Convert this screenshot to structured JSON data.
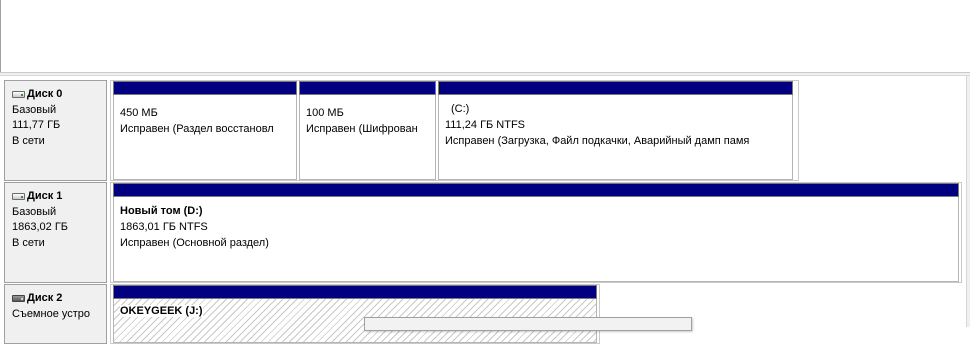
{
  "disks": [
    {
      "name": "Диск 0",
      "type": "Базовый",
      "size": "111,77 ГБ",
      "status": "В сети",
      "icon": "hard-disk-icon",
      "partitions": [
        {
          "size_text": "450 МБ",
          "status_text": "Исправен (Раздел восстановл"
        },
        {
          "size_text": "100 МБ",
          "status_text": "Исправен (Шифрован"
        },
        {
          "label": "(C:)",
          "size_text": "111,24 ГБ NTFS",
          "status_text": "Исправен (Загрузка, Файл подкачки, Аварийный дамп памя"
        }
      ]
    },
    {
      "name": "Диск 1",
      "type": "Базовый",
      "size": "1863,02 ГБ",
      "status": "В сети",
      "icon": "hard-disk-icon",
      "partitions": [
        {
          "label": "Новый том  (D:)",
          "size_text": "1863,01 ГБ NTFS",
          "status_text": "Исправен (Основной раздел)"
        }
      ]
    },
    {
      "name": "Диск 2",
      "type": "Съемное устро",
      "icon": "removable-disk-icon",
      "partitions": [
        {
          "label": "OKEYGEEK  (J:)"
        }
      ]
    }
  ],
  "colors": {
    "primary_partition_band": "#000080",
    "panel_background": "#f0f0f0",
    "selected_hatch": "#c8c8c8"
  }
}
